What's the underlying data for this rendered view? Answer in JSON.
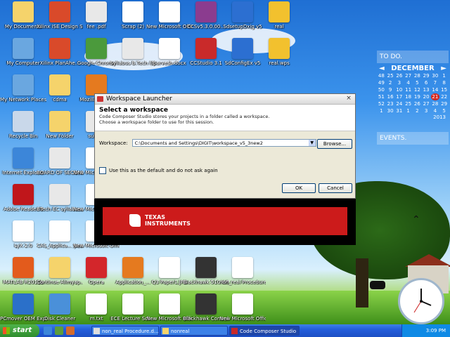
{
  "desktop": {
    "icons": [
      {
        "label": "My Documents",
        "icon": "folder-docs-icon",
        "color": "#f5d36b"
      },
      {
        "label": "Xilinx ISE Design Su...",
        "icon": "xilinx-icon",
        "color": "#d94a2a"
      },
      {
        "label": "fee .pdf",
        "icon": "pdf-icon",
        "color": "#e8e8e8"
      },
      {
        "label": "Scrap (2)",
        "icon": "shortcut-icon",
        "color": "#ffffff"
      },
      {
        "label": "New Microsoft Office Wor...",
        "icon": "word-doc-icon",
        "color": "#ffffff"
      },
      {
        "label": "CCSv5.3.0.00...",
        "icon": "winrar-icon",
        "color": "#8b3c8f"
      },
      {
        "label": "SdsetupDxig v5",
        "icon": "installer-icon",
        "color": "#2c6fd1"
      },
      {
        "label": "real",
        "icon": "app-icon",
        "color": "#f2c12e"
      },
      {
        "label": "My Computer",
        "icon": "computer-icon",
        "color": "#6aa7e0"
      },
      {
        "label": "Xilinx PlanAhe...",
        "icon": "xilinx-icon",
        "color": "#d94a2a"
      },
      {
        "label": "Google Chrome",
        "icon": "chrome-icon",
        "color": "#4b9a3c"
      },
      {
        "label": "Syllabus B.Tech (Elect...",
        "icon": "pdf-icon",
        "color": "#e8e8e8"
      },
      {
        "label": "parvesh.docx",
        "icon": "word-doc-icon",
        "color": "#ffffff"
      },
      {
        "label": "CCStudio 3.1",
        "icon": "ccs-icon",
        "color": "#c92a2a"
      },
      {
        "label": "SdConfigEx v5",
        "icon": "installer-icon",
        "color": "#2c6fd1"
      },
      {
        "label": "real.wps",
        "icon": "app-icon",
        "color": "#f2c12e"
      },
      {
        "label": "My Network Places",
        "icon": "network-icon",
        "color": "#6aa7e0"
      },
      {
        "label": "cdma",
        "icon": "folder-icon",
        "color": "#f5d36b"
      },
      {
        "label": "Mozilla Firef...",
        "icon": "firefox-icon",
        "color": "#e57a1f"
      },
      {
        "label": "Recycle Bin",
        "icon": "recycle-bin-icon",
        "color": "#c9d8ea"
      },
      {
        "label": "New Folder",
        "icon": "folder-icon",
        "color": "#f5d36b"
      },
      {
        "label": "sul.pdf",
        "icon": "pdf-icon",
        "color": "#e8e8e8"
      },
      {
        "label": "Internet Explorer",
        "icon": "ie-icon",
        "color": "#3c86d9"
      },
      {
        "label": "BOARD OF SECONDA...",
        "icon": "pdf-icon",
        "color": "#e8e8e8"
      },
      {
        "label": "New Microsoft Office Exc...",
        "icon": "word-doc-icon",
        "color": "#ffffff"
      },
      {
        "label": "Adobe Reader 9",
        "icon": "adobe-reader-icon",
        "color": "#c0161b"
      },
      {
        "label": "BTech EC syllabus.pdf",
        "icon": "pdf-icon",
        "color": "#e8e8e8"
      },
      {
        "label": "New Microsoft Office Wor...",
        "icon": "word-doc-icon",
        "color": "#ffffff"
      },
      {
        "label": "LyX 2.0",
        "icon": "lyx-icon",
        "color": "#ffffff"
      },
      {
        "label": "CAS_Applica... year 2014-1...",
        "icon": "word-doc-icon",
        "color": "#ffffff"
      },
      {
        "label": "New Microsoft Office Wor...",
        "icon": "word-doc-icon",
        "color": "#ffffff"
      },
      {
        "label": "MATLAB R2011b",
        "icon": "matlab-icon",
        "color": "#e35b1c"
      },
      {
        "label": "Continue Alimyap...",
        "icon": "folder-icon",
        "color": "#f5d36b"
      },
      {
        "label": "Opera",
        "icon": "opera-icon",
        "color": "#d3262b"
      },
      {
        "label": "Application_...",
        "icon": "firefox-icon",
        "color": "#e57a1f"
      },
      {
        "label": "Q3 Paper1.JPG",
        "icon": "image-icon",
        "color": "#ffffff"
      },
      {
        "label": "Blackhawk 510 WPI CFG",
        "icon": "blackhawk-icon",
        "color": "#333333"
      },
      {
        "label": "non_real Procedure",
        "icon": "word-doc-icon",
        "color": "#ffffff"
      },
      {
        "label": "PCmover OEM Express",
        "icon": "pcmover-icon",
        "color": "#2b70c9"
      },
      {
        "label": "Disk Cleaner",
        "icon": "disk-cleaner-icon",
        "color": "#4a90d9"
      },
      {
        "label": "m.txt",
        "icon": "text-file-icon",
        "color": "#ffffff"
      },
      {
        "label": "ECE Lecture Sch...",
        "icon": "word-doc-icon",
        "color": "#ffffff"
      },
      {
        "label": "New Microsoft Office Wor...",
        "icon": "word-doc-icon",
        "color": "#ffffff"
      },
      {
        "label": "Blackhawk Control Pa...",
        "icon": "blackhawk-icon",
        "color": "#333333"
      },
      {
        "label": "New Microsoft Office Wor...",
        "icon": "word-doc-icon",
        "color": "#ffffff"
      }
    ]
  },
  "widgets": {
    "todo_title": "TO DO.",
    "events_title": "EVENTS.",
    "calendar": {
      "month": "DECEMBER",
      "prev": "◄",
      "next": "►",
      "rows": [
        [
          "48",
          "25",
          "26",
          "27",
          "28",
          "29",
          "30",
          "1"
        ],
        [
          "49",
          "2",
          "3",
          "4",
          "5",
          "6",
          "7",
          "8"
        ],
        [
          "50",
          "9",
          "10",
          "11",
          "12",
          "13",
          "14",
          "15"
        ],
        [
          "51",
          "16",
          "17",
          "18",
          "19",
          "20",
          "21",
          "22"
        ],
        [
          "52",
          "23",
          "24",
          "25",
          "26",
          "27",
          "28",
          "29"
        ],
        [
          "1",
          "30",
          "31",
          "1",
          "2",
          "3",
          "4",
          "5"
        ]
      ],
      "today": "21",
      "year": "2013"
    }
  },
  "dialog": {
    "title": "Workspace Launcher",
    "close": "×",
    "heading": "Select a workspace",
    "description_line1": "Code Composer Studio stores your projects in a folder called a workspace.",
    "description_line2": "Choose a workspace folder to use for this session.",
    "workspace_label": "Workspace:",
    "workspace_value": "C:\\Documents and Settings\\DIGIT\\workspace_v5_3new2",
    "browse_label": "Browse...",
    "default_checkbox_label": "Use this as the default and do not ask again",
    "default_checked": false,
    "ok_label": "OK",
    "cancel_label": "Cancel"
  },
  "splash": {
    "brand_line1": "TEXAS",
    "brand_line2": "INSTRUMENTS",
    "color": "#cc1b1b"
  },
  "taskbar": {
    "start_label": "start",
    "tasks": [
      {
        "label": "non_real Procedure.d...",
        "icon": "word-doc-icon",
        "active": false
      },
      {
        "label": "nonreal",
        "icon": "folder-icon",
        "active": false
      },
      {
        "label": "Code Composer Studio",
        "icon": "ccs-icon",
        "active": true
      }
    ],
    "time": "3:09 PM"
  }
}
